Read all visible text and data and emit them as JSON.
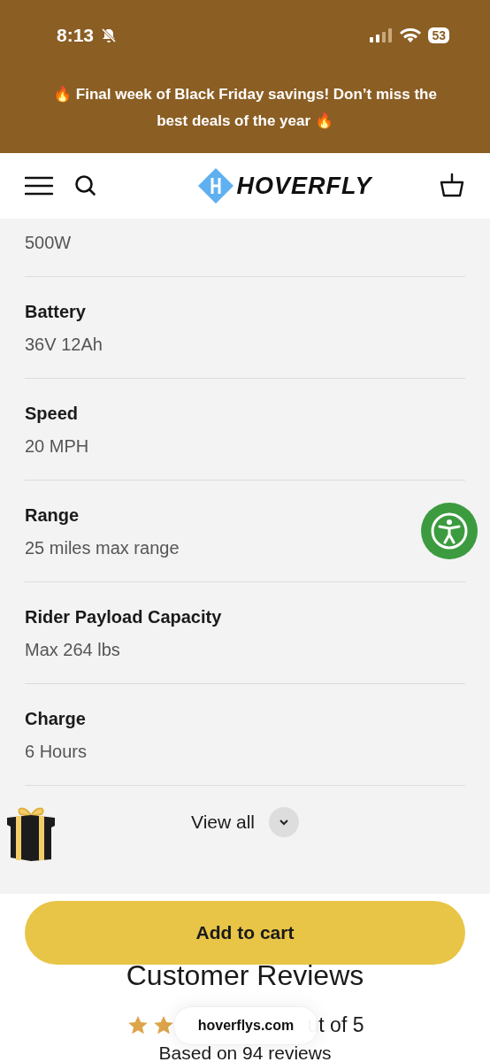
{
  "status_bar": {
    "time": "8:13",
    "battery": "53"
  },
  "promo_banner": {
    "text": "🔥 Final week of Black Friday savings! Don’t miss the best deals of the year 🔥"
  },
  "header": {
    "logo": "HOVERFLY"
  },
  "specs": [
    {
      "value": "500W"
    },
    {
      "name": "Battery",
      "value": "36V 12Ah"
    },
    {
      "name": "Speed",
      "value": "20 MPH"
    },
    {
      "name": "Range",
      "value": "25 miles max range"
    },
    {
      "name": "Rider Payload Capacity",
      "value": "Max 264 lbs"
    },
    {
      "name": "Charge",
      "value": "6 Hours"
    }
  ],
  "view_all": {
    "label": "View all"
  },
  "add_to_cart": {
    "label": "Add to cart"
  },
  "reviews": {
    "title": "Customer Reviews",
    "rating_icons": [
      {
        "kind": "star"
      },
      {
        "kind": "star"
      }
    ],
    "rating_text": "ut of 5",
    "summary": "Based on 94 reviews"
  },
  "url_pill": {
    "text": "hoverflys.com"
  }
}
